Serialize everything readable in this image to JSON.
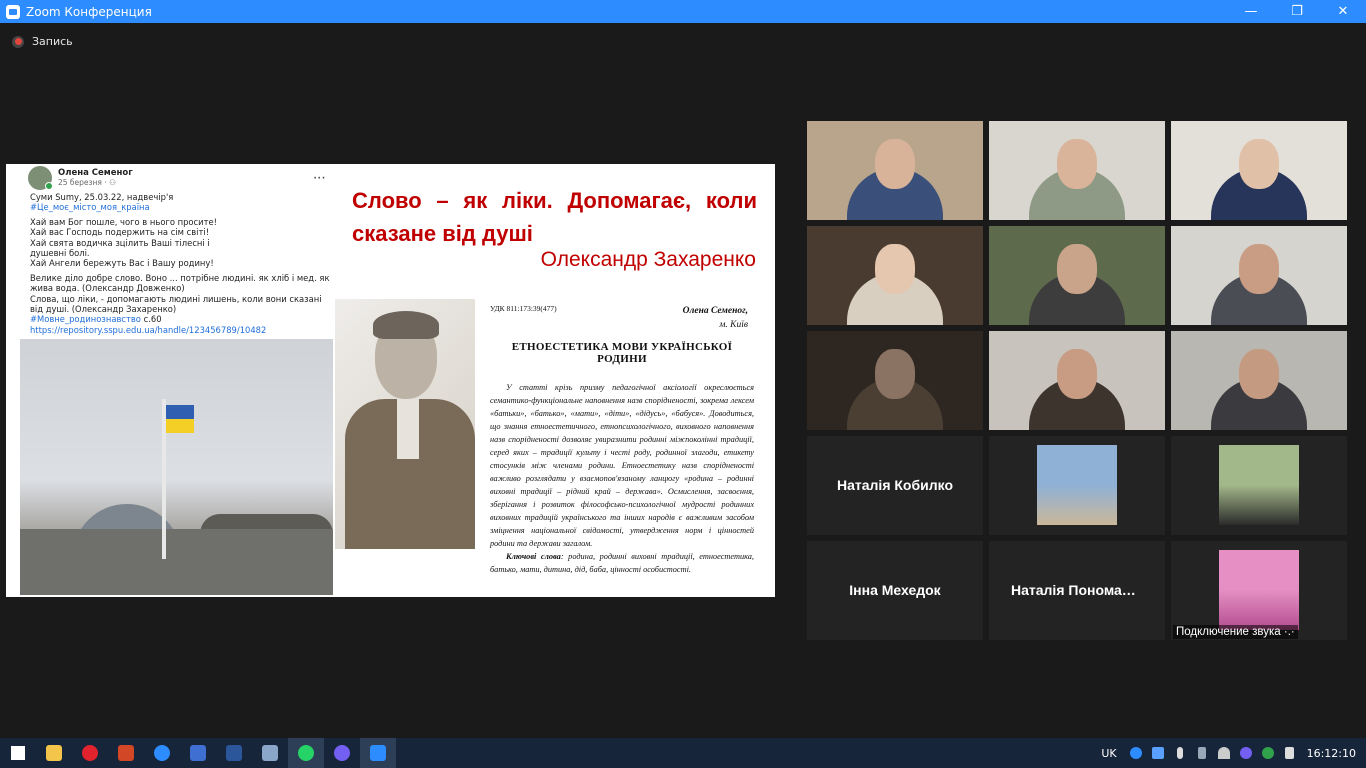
{
  "window": {
    "title": "Zoom Конференция",
    "minimize": "—",
    "restore": "❐",
    "close": "✕"
  },
  "recording": {
    "label": "Запись"
  },
  "shared_screen": {
    "post": {
      "author": "Олена Семеног",
      "date": "25 березня · ⚇",
      "more": "···",
      "location": "Суми    Sumy, 25.03.22, надвечір'я",
      "hashtag1": "#Це_моє_місто_моя_країна",
      "lines": [
        "Хай вам Бог пошле, чого в нього просите!",
        "Хай вас Господь подержить на сім світі!",
        "Хай свята водичка зцілить Ваші тілесні і",
        "душевні болі.",
        "Хай Ангели бережуть Вас і Вашу родину!"
      ],
      "paragraph1": "Велике діло добре слово. Воно ... потрібне людині. як хліб і мед. як жива вода. (Олександр Довженко)",
      "paragraph2": "Слова, що ліки, - допомагають людині лишень, коли вони сказані від душі. (Олександр Захаренко)",
      "hashtag2": "#Мовне_родинознавство",
      "page_ref": " с.60",
      "url": "https://repository.sspu.edu.ua/handle/123456789/10482"
    },
    "quote": "Слово – як ліки. Допомагає, коли сказане від душі",
    "quote_author": "Олександр Захаренко",
    "article": {
      "udk": "УДК 811:173:39(477)",
      "author": "Олена Семеног,",
      "city": "м. Київ",
      "heading": "ЕТНОЕСТЕТИКА МОВИ УКРАЇНСЬКОЇ РОДИНИ",
      "abstract": "У статті крізь призму педагогічної аксіології окреслюється семантико-функціональне наповнення назв спорідненості, зокрема лексем «батьки», «батько», «мати», «діти», «дідусь», «бабуся». Доводиться, що знання етноестетичного, етнопсихологічного, виховного наповнення назв спорідненості дозволяє увиразнити родинні міжпоколінні традиції, серед яких – традиції культу і честі роду, родинної злагоди, етикету стосунків між членами родини. Етноестетику назв спорідненості важливо розглядати у взаємопов'язаному ланцюгу «родина – родинні виховні традиції – рідний край – держава». Осмислення, засвоєння, зберігання і розвиток філософсько-психологічної мудрості родинних виховних традицій українського та інших народів є важливим засобом зміцнення національної свідомості, утвердження норм і цінностей родини та держави загалом.",
      "keywords_label": "Ключові слова",
      "keywords": ": родина, родинні виховні традиції, етноестетика, батько, мати, дитина, дід, баба, цінності особистості."
    }
  },
  "participants": [
    {
      "type": "video",
      "bg": "#b8a58c",
      "person": "#3a4f7a",
      "face": "#d8b39a"
    },
    {
      "type": "video",
      "bg": "#d9d6cf",
      "person": "#8e9a85",
      "face": "#d9b49b"
    },
    {
      "type": "video",
      "bg": "#e3e0da",
      "person": "#27355a",
      "face": "#e0c0a6"
    },
    {
      "type": "video",
      "bg": "#4a3b30",
      "person": "#d8cfc1",
      "face": "#e5c6ae",
      "speaker": true
    },
    {
      "type": "video",
      "bg": "#5e6a4c",
      "person": "#3d3d3d",
      "face": "#c9a48a"
    },
    {
      "type": "video",
      "bg": "#d6d4cf",
      "person": "#4b4d55",
      "face": "#c99d83"
    },
    {
      "type": "video",
      "bg": "#2e2721",
      "person": "#4b3f33",
      "face": "#8a7362"
    },
    {
      "type": "video",
      "bg": "#c8c4bd",
      "person": "#3e342e",
      "face": "#c79c82"
    },
    {
      "type": "video",
      "bg": "#b9b7b2",
      "person": "#3b3b3f",
      "face": "#c49a80"
    },
    {
      "type": "name",
      "name": "Наталія Кобилко"
    },
    {
      "type": "picture",
      "pic_top": "#8fb1d6",
      "pic_bottom": "#c9b79a"
    },
    {
      "type": "picture",
      "pic_top": "#a3b88a",
      "pic_bottom": "#2b2b2b"
    },
    {
      "type": "name",
      "name": "Інна Мехедок"
    },
    {
      "type": "name",
      "name": "Наталія  Пономаренко"
    },
    {
      "type": "picture",
      "pic_top": "#e58fc4",
      "pic_bottom": "#b34d8f",
      "status": "Подключение звука ·.·"
    }
  ],
  "taskbar": {
    "apps": [
      "start",
      "file-explorer",
      "opera",
      "presentation",
      "zoom-app",
      "save",
      "word",
      "paint",
      "whatsapp",
      "viber",
      "zoom"
    ],
    "lang": "UK",
    "time": "16:12:10"
  }
}
